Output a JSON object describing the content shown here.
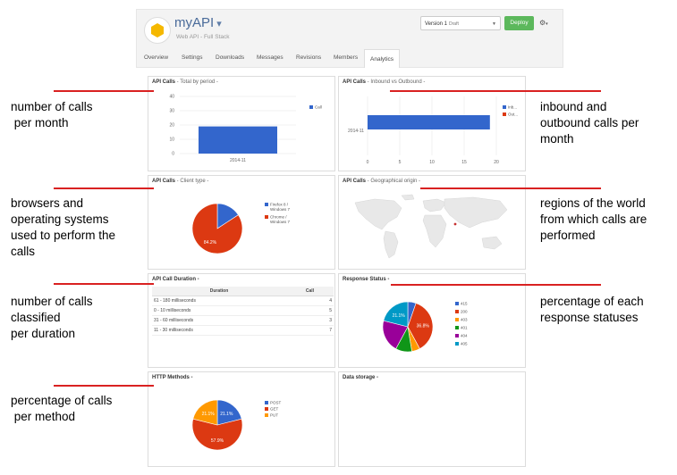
{
  "header": {
    "app_name": "myAPI",
    "app_caret": "▾",
    "subtitle": "Web API - Full Stack",
    "version_label": "Version 1",
    "version_state": "Draft",
    "deploy_label": "Deploy",
    "gear_icon": "gear-icon",
    "tabs": [
      "Overview",
      "Settings",
      "Downloads",
      "Messages",
      "Revisions",
      "Members",
      "Analytics"
    ],
    "active_tab": "Analytics"
  },
  "panels": {
    "calls_period": {
      "title": "API Calls",
      "subtitle": " - Total by period -"
    },
    "calls_inout": {
      "title": "API Calls",
      "subtitle": " - Inbound vs Outbound -"
    },
    "client_type": {
      "title": "API Calls",
      "subtitle": " - Client type -"
    },
    "geo": {
      "title": "API Calls",
      "subtitle": " - Geographical origin -"
    },
    "duration": {
      "title": "API Call Duration -"
    },
    "response": {
      "title": "Response Status -"
    },
    "http": {
      "title": "HTTP Methods -"
    },
    "storage": {
      "title": "Data storage -"
    }
  },
  "duration_table": {
    "headers": [
      "Duration",
      "Call"
    ],
    "rows": [
      [
        "61 - 180 milliseconds",
        "4"
      ],
      [
        "0 - 10 milliseconds",
        "5"
      ],
      [
        "31 - 60 milliseconds",
        "3"
      ],
      [
        "11 - 30 milliseconds",
        "7"
      ]
    ]
  },
  "chart_data": [
    {
      "type": "bar",
      "categories": [
        "2014-11"
      ],
      "series": [
        {
          "name": "Call",
          "values": [
            19
          ]
        }
      ],
      "ylim": [
        0,
        40
      ],
      "yticks": [
        "0",
        "10",
        "20",
        "30",
        "40"
      ],
      "color": "#3366cc"
    },
    {
      "type": "bar",
      "orientation": "horizontal",
      "categories": [
        "2014-11"
      ],
      "series": [
        {
          "name": "Inb...",
          "values": [
            19
          ]
        },
        {
          "name": "Out...",
          "values": [
            0
          ]
        }
      ],
      "xlim": [
        0,
        20
      ],
      "xticks": [
        "0",
        "5",
        "10",
        "15",
        "20"
      ],
      "colors": [
        "#3366cc",
        "#dc3912"
      ]
    },
    {
      "type": "pie",
      "labels": [
        "Firefox 8 / Windows 7",
        "Chrome / Windows 7"
      ],
      "legend_lines": [
        [
          "Firefox 8 /",
          "Windows 7"
        ],
        [
          "Chrome /",
          "Windows 7"
        ]
      ],
      "values": [
        15.8,
        84.2
      ],
      "slice_labels": [
        "",
        "84.2%"
      ],
      "colors": [
        "#3366cc",
        "#dc3912"
      ]
    },
    {
      "type": "pie",
      "labels": [
        "415",
        "200",
        "403",
        "401",
        "404",
        "405"
      ],
      "values": [
        5.3,
        36.8,
        5.3,
        10.5,
        21.0,
        21.1
      ],
      "slice_labels": [
        "",
        "36.8%",
        "",
        "",
        "",
        "21.1%"
      ],
      "colors": [
        "#3366cc",
        "#dc3912",
        "#ff9900",
        "#109618",
        "#990099",
        "#0099c6"
      ]
    },
    {
      "type": "pie",
      "labels": [
        "POST",
        "GET",
        "PUT"
      ],
      "values": [
        21.1,
        57.8,
        21.1
      ],
      "slice_labels": [
        "21.1%",
        "57.9%",
        "21.1%"
      ],
      "colors": [
        "#3366cc",
        "#dc3912",
        "#ff9900"
      ]
    }
  ],
  "notes": {
    "n1": "number of calls\n per month",
    "n2": "inbound and\noutbound calls per\nmonth",
    "n3": "browsers and\noperating systems\nused to perform the\ncalls",
    "n4": "regions of the world\nfrom which calls are\nperformed",
    "n5": "number of calls\nclassified\nper duration",
    "n6": "percentage of each\nresponse statuses",
    "n7": "percentage of calls\n per method"
  },
  "colors": {
    "accent_line": "#d92121",
    "deploy": "#5cb85c",
    "title_blue": "#4a6b9a"
  }
}
